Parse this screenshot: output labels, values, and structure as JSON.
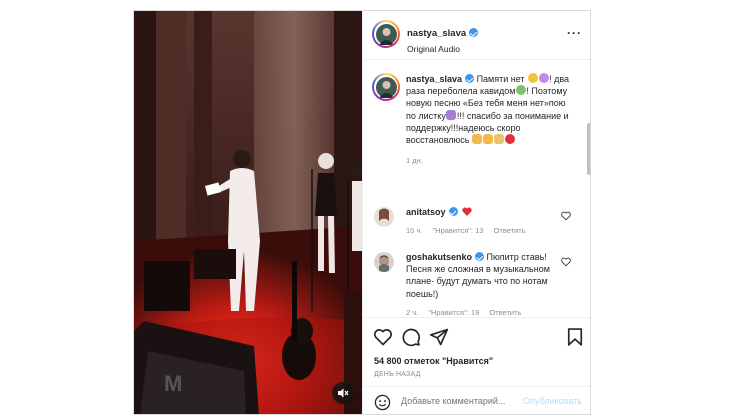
{
  "post": {
    "author": {
      "username": "nastya_slava",
      "verified": true,
      "audio": "Original Audio"
    },
    "menu_icon": "more-horizontal-icon",
    "caption": {
      "username": "nastya_slava",
      "text_part1": "Памяти нет",
      "text_part2": "два раза переболела кавидом",
      "text_part3": "Поэтому новую песню «Без тебя меня нет»пою по листку",
      "text_part4": "!!! спасибо за понимание и поддержку!!!надеюсь скоро восстановлюсь",
      "time": "1 дн."
    },
    "comments": [
      {
        "username": "anitatsoy",
        "verified": true,
        "text": "",
        "emoji": "red-heart",
        "time": "10 ч.",
        "likes": "\"Нравится\": 13",
        "reply": "Ответить"
      },
      {
        "username": "goshakutsenko",
        "verified": true,
        "text": "Пюпитр ставь! Песня же сложная в музыкальном плане- будут думать что по нотам поешь!)",
        "time": "2 ч.",
        "likes": "\"Нравится\": 19",
        "reply": "Ответить"
      }
    ],
    "likes_text": "54 800 отметок \"Нравится\"",
    "date_text": "ДЕНЬ НАЗАД",
    "comment_placeholder": "Добавьте комментарий...",
    "publish_label": "Опубликовать",
    "colors": {
      "verified_blue": "#3897f0",
      "heart_red": "#ed4956",
      "publish_disabled": "#b2dffc",
      "muted_text": "#8e8e8e"
    },
    "icons": [
      "heart-icon",
      "comment-icon",
      "share-icon",
      "bookmark-icon",
      "emoji-icon",
      "mute-icon"
    ]
  }
}
